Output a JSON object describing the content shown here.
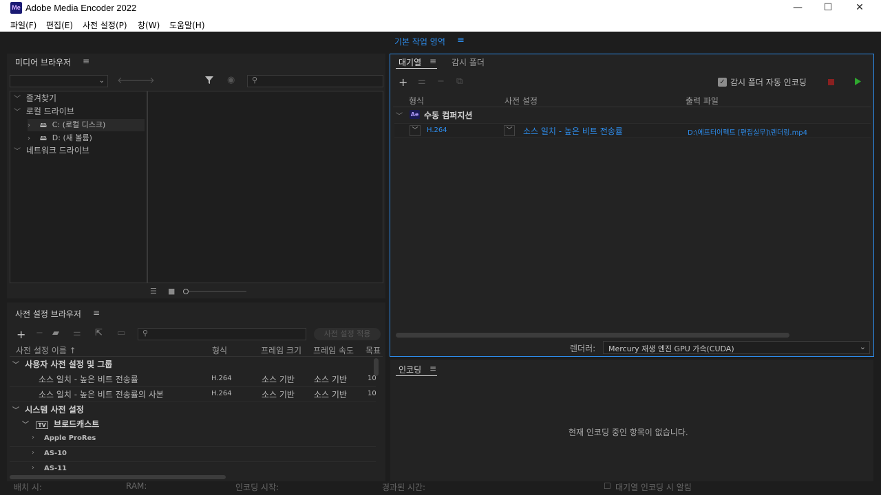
{
  "window": {
    "app_icon_text": "Me",
    "title": "Adobe Media Encoder 2022",
    "minimize": "—",
    "maximize": "☐",
    "close": "✕"
  },
  "menu": {
    "items": [
      "파일(F)",
      "편집(E)",
      "사전 설정(P)",
      "창(W)",
      "도움말(H)"
    ]
  },
  "workspace": {
    "label": "기본 작업 영역",
    "menu_icon": "≡"
  },
  "media_browser": {
    "title": "미디어 브라우저",
    "menu_icon": "≡",
    "tree": {
      "favorites": "즐겨찾기",
      "local_drives": "로컬 드라이브",
      "drive_c": "C: (로컬 디스크)",
      "drive_d": "D: (새 볼륨)",
      "network_drives": "네트워크 드라이브"
    }
  },
  "preset_browser": {
    "title": "사전 설정 브라우저",
    "menu_icon": "≡",
    "apply_button": "사전 설정 적용",
    "columns": [
      "사전 설정 이름 ↑",
      "형식",
      "프레임 크기",
      "프레임 속도",
      "목표"
    ],
    "user_group": "사용자 사전 설정 및 그룹",
    "user_presets": [
      {
        "name": "소스 일치 - 높은 비트 전송률",
        "format": "H.264",
        "frame_size": "소스 기반",
        "frame_rate": "소스 기반",
        "target": "10"
      },
      {
        "name": "소스 일치 - 높은 비트 전송률의 사본",
        "format": "H.264",
        "frame_size": "소스 기반",
        "frame_rate": "소스 기반",
        "target": "10"
      }
    ],
    "system_group": "시스템 사전 설정",
    "broadcast_group": "브로드캐스트",
    "broadcast_icon": "TV",
    "broadcast_items": [
      "Apple ProRes",
      "AS-10",
      "AS-11"
    ]
  },
  "queue": {
    "tab_queue": "대기열",
    "tab_menu_icon": "≡",
    "tab_watch": "감시 폴더",
    "auto_encode_label": "감시 폴더 자동 인코딩",
    "auto_encode_checked": true,
    "columns": [
      "형식",
      "사전 설정",
      "출력 파일"
    ],
    "composition_badge": "Ae",
    "composition_name": "수동 컴퍼지션",
    "item": {
      "format": "H.264",
      "preset": "소스 일치 - 높은 비트 전송률",
      "output": "D:\\에프터이펙트 [편집실무]\\렌더링.mp4"
    },
    "renderer_label": "렌더러:",
    "renderer_value": "Mercury 재생 엔진 GPU 가속(CUDA)",
    "colors": {
      "accent": "#2d8ceb",
      "start": "#2ea82e",
      "stop": "#8a2020"
    }
  },
  "encoding": {
    "title": "인코딩",
    "menu_icon": "≡",
    "empty_message": "현재 인코딩 중인 항목이 없습니다."
  },
  "status": {
    "left": "배치 시:",
    "mid1": "RAM:",
    "mid2": "인코딩 시작:",
    "mid3": "경과된 시간:",
    "right": "대기열 인코딩 시 알림"
  }
}
